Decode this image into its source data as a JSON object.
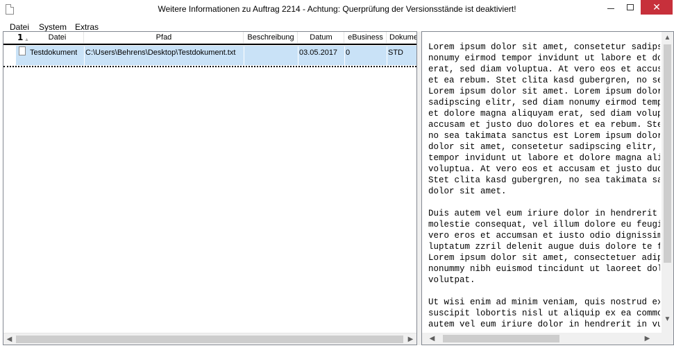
{
  "window": {
    "title": "Weitere Informationen zu Auftrag 2214 - Achtung: Querprüfung der Versionsstände ist deaktiviert!",
    "controls": {
      "minimize": "–",
      "maximize": "□",
      "close": "✕"
    }
  },
  "menu": [
    "Datei",
    "System",
    "Extras"
  ],
  "grid": {
    "sort_indicator": "1",
    "sort_arrow": "▲",
    "columns": [
      "Datei",
      "Pfad",
      "Beschreibung",
      "Datum",
      "eBusiness",
      "Dokume"
    ],
    "rows": [
      {
        "datei": "Testdokument",
        "pfad": "C:\\Users\\Behrens\\Desktop\\Testdokument.txt",
        "beschreibung": "",
        "datum": "03.05.2017",
        "ebusiness": "0",
        "dokument": "STD"
      }
    ],
    "scroll_left": "◀",
    "scroll_right": "▶"
  },
  "textpanel": {
    "content": "Lorem ipsum dolor sit amet, consetetur sadipscing elitr, sed diam\nnonumy eirmod tempor invidunt ut labore et dolore magna aliquyam\nerat, sed diam voluptua. At vero eos et accusam et justo duo dolores\net ea rebum. Stet clita kasd gubergren, no sea takimata sanctus est\nLorem ipsum dolor sit amet. Lorem ipsum dolor sit amet, consetetur\nsadipscing elitr, sed diam nonumy eirmod tempor invidunt ut labore\net dolore magna aliquyam erat, sed diam voluptua. At vero eos et\naccusam et justo duo dolores et ea rebum. Stet clita kasd gubergren,\nno sea takimata sanctus est Lorem ipsum dolor sit amet. Lorem ipsum\ndolor sit amet, consetetur sadipscing elitr, sed diam nonumy eirmod\ntempor invidunt ut labore et dolore magna aliquyam erat, sed diam\nvoluptua. At vero eos et accusam et justo duo dolores et ea rebum.\nStet clita kasd gubergren, no sea takimata sanctus est Lorem ipsum\ndolor sit amet.\n\nDuis autem vel eum iriure dolor in hendrerit in vulputate velit esse\nmolestie consequat, vel illum dolore eu feugiat nulla facilisis at\nvero eros et accumsan et iusto odio dignissim qui blandit praesent\nluptatum zzril delenit augue duis dolore te feugait nulla facilisi.\nLorem ipsum dolor sit amet, consectetuer adipiscing elit, sed diam\nnonummy nibh euismod tincidunt ut laoreet dolore magna aliquam erat\nvolutpat.\n\nUt wisi enim ad minim veniam, quis nostrud exerci tation ullamcorper\nsuscipit lobortis nisl ut aliquip ex ea commodo consequat. Duis\nautem vel eum iriure dolor in hendrerit in vulputate velit esse",
    "scroll_up": "▲",
    "scroll_down": "▼",
    "scroll_left": "◀",
    "scroll_right": "▶"
  }
}
